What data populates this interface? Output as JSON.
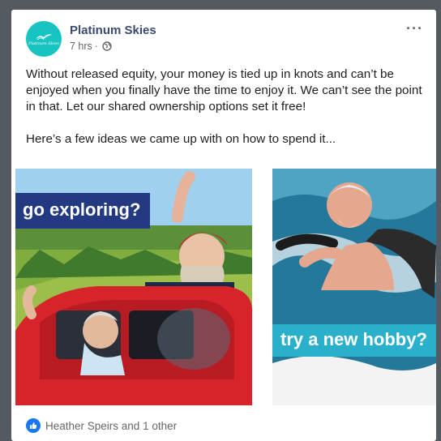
{
  "post": {
    "page_name": "Platinum Skies",
    "time": "7 hrs",
    "separator": "·",
    "body_paragraph_1": "Without released equity, your money is tied up in knots and can’t be enjoyed when you finally have the time to enjoy it. We can’t see the point in that. Let our shared ownership options set it free!",
    "body_paragraph_2": "Here’s a few ideas we came up with on how to spend it...",
    "avatar_logo_text": "Platinum Skies",
    "more_icon": "more-options-icon",
    "privacy_icon": "globe-icon"
  },
  "images": {
    "left_caption": "go exploring?",
    "right_caption": "try a new hobby?"
  },
  "reactions": {
    "text": "Heather Speirs and 1 other",
    "icon": "like-icon"
  },
  "colors": {
    "brand_teal": "#17c4c2",
    "caption_navy": "#233a82",
    "caption_teal": "#2bb0cc",
    "like_blue": "#1877f2"
  }
}
